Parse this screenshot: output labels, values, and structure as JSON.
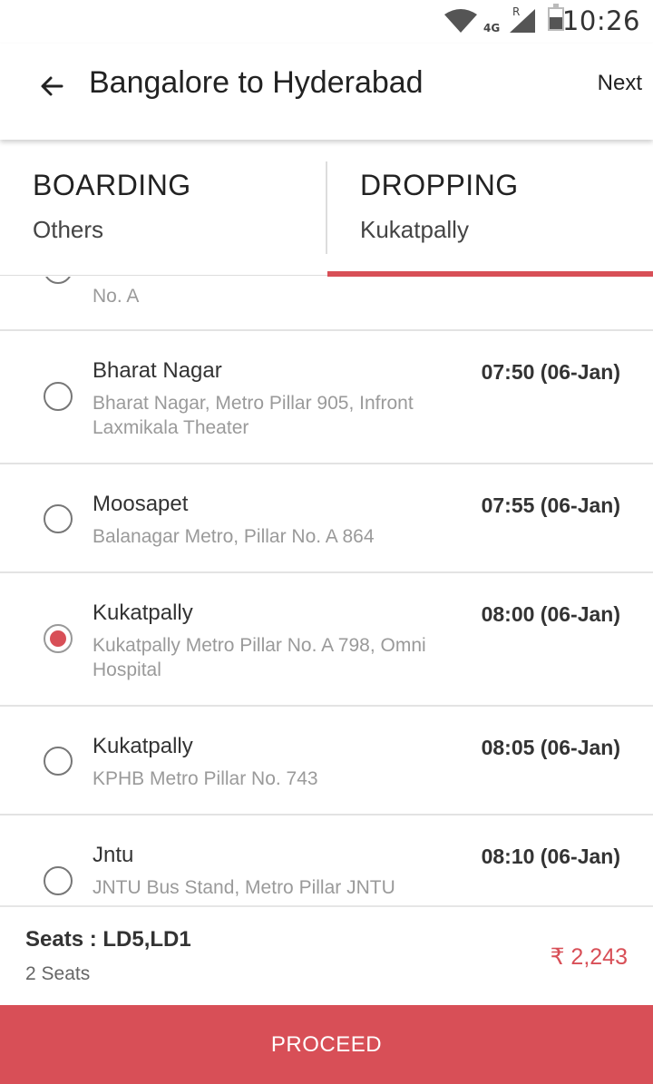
{
  "status_bar": {
    "time": "10:26",
    "network": "4G",
    "roaming": "R"
  },
  "app_bar": {
    "title": "Bangalore to Hyderabad",
    "next_label": "Next"
  },
  "tabs": {
    "boarding": {
      "title": "BOARDING",
      "subtitle": "Others"
    },
    "dropping": {
      "title": "DROPPING",
      "subtitle": "Kukatpally"
    },
    "active": "dropping"
  },
  "drop_points": [
    {
      "name": "",
      "address": "No. A",
      "time": "",
      "selected": false
    },
    {
      "name": "Bharat Nagar",
      "address": "Bharat Nagar, Metro Pillar 905, Infront Laxmikala Theater",
      "time": "07:50 (06-Jan)",
      "selected": false
    },
    {
      "name": "Moosapet",
      "address": "Balanagar Metro, Pillar No. A 864",
      "time": "07:55 (06-Jan)",
      "selected": false
    },
    {
      "name": "Kukatpally",
      "address": "Kukatpally Metro Pillar No. A 798, Omni Hospital",
      "time": "08:00 (06-Jan)",
      "selected": true
    },
    {
      "name": "Kukatpally",
      "address": "KPHB Metro Pillar No. 743",
      "time": "08:05 (06-Jan)",
      "selected": false
    },
    {
      "name": "Jntu",
      "address": "JNTU Bus Stand, Metro Pillar JNTU",
      "time": "08:10 (06-Jan)",
      "selected": false
    }
  ],
  "summary": {
    "seats_label": "Seats : LD5,LD1",
    "seats_count": "2 Seats",
    "price": "₹ 2,243"
  },
  "proceed_label": "PROCEED",
  "colors": {
    "accent": "#d84f57"
  }
}
